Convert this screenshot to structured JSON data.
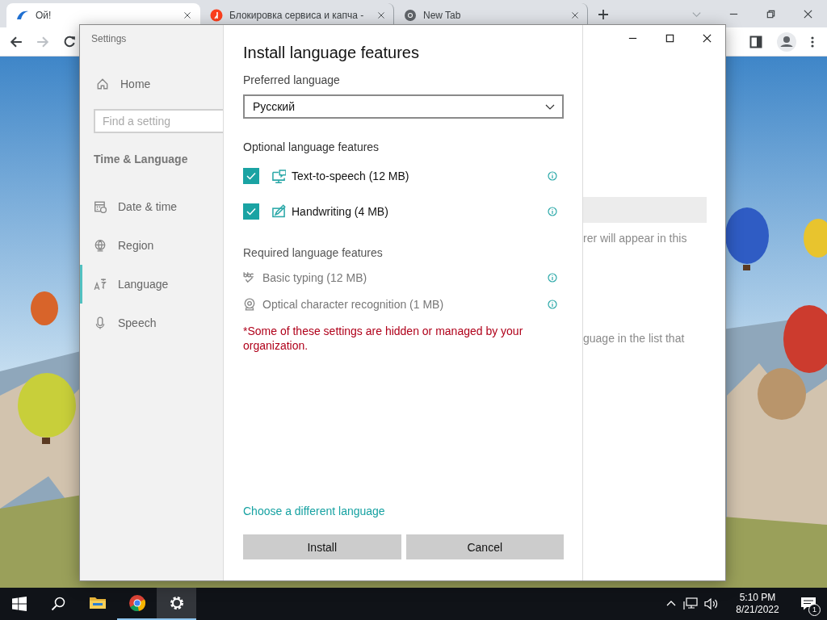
{
  "browser": {
    "tabs": [
      {
        "title": "Ой!",
        "selected": true,
        "kind": "swoosh"
      },
      {
        "title": "Блокировка сервиса и капча -",
        "selected": false,
        "kind": "badge"
      },
      {
        "title": "New Tab",
        "selected": false,
        "kind": "chrome"
      }
    ],
    "nav_buttons": [
      {
        "kind": "back",
        "disabled": false
      },
      {
        "kind": "forward",
        "disabled": true
      },
      {
        "kind": "reload",
        "disabled": false
      }
    ]
  },
  "settings_window": {
    "title": "Settings",
    "sidebar": {
      "home": "Home",
      "search": {
        "placeholder": "Find a setting"
      },
      "section": "Time & Language",
      "items": [
        {
          "label": "Date & time",
          "kind": "date",
          "selected": false
        },
        {
          "label": "Region",
          "kind": "region",
          "selected": false
        },
        {
          "label": "Language",
          "kind": "language",
          "selected": true
        },
        {
          "label": "Speech",
          "kind": "speech",
          "selected": false
        }
      ]
    },
    "dialog": {
      "title": "Install language features",
      "preferred_label": "Preferred language",
      "preferred_value": "Русский",
      "optional_label": "Optional language features",
      "optional_features": [
        {
          "label": "Text-to-speech (12 MB)",
          "kind": "speech",
          "checked": true
        },
        {
          "label": "Handwriting (4 MB)",
          "kind": "handwriting",
          "checked": true
        }
      ],
      "required_label": "Required language features",
      "required_features": [
        {
          "label": "Basic typing (12 MB)",
          "kind": "typing"
        },
        {
          "label": "Optical character recognition (1 MB)",
          "kind": "ocr"
        }
      ],
      "note": "*Some of these settings are hidden or managed by your organization.",
      "link": "Choose a different language",
      "buttons": [
        "Install",
        "Cancel"
      ]
    },
    "background_texts": [
      "rer will appear in this",
      "guage in the list that"
    ]
  },
  "taskbar": {
    "apps": [
      {
        "kind": "explorer",
        "running": false,
        "selected": false
      },
      {
        "kind": "chrome",
        "running": true,
        "selected": false
      },
      {
        "kind": "settings",
        "running": true,
        "selected": true
      }
    ],
    "time": "5:10 PM",
    "date": "8/21/2022",
    "notifications": "1"
  }
}
